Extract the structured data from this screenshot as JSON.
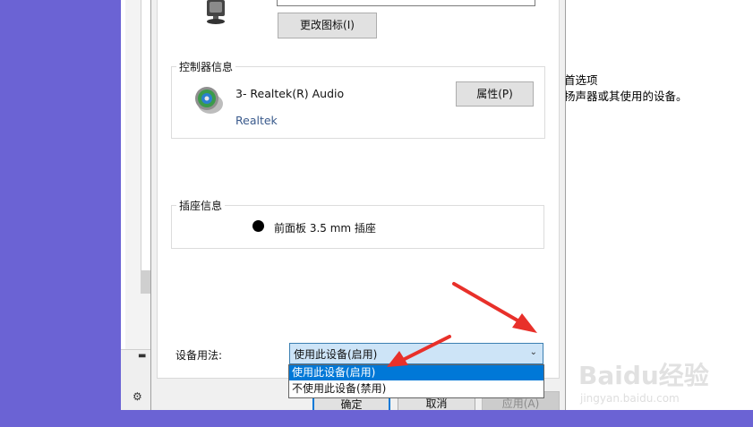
{
  "device_props": {
    "change_icon_button": "更改图标(I)",
    "controller": {
      "group_title": "控制器信息",
      "name": "3- Realtek(R) Audio",
      "vendor_link": "Realtek",
      "properties_button": "属性(P)"
    },
    "jack": {
      "group_title": "插座信息",
      "description": "前面板 3.5 mm 插座"
    },
    "usage": {
      "label": "设备用法:",
      "selected": "使用此设备(启用)",
      "options": [
        "使用此设备(启用)",
        "不使用此设备(禁用)"
      ]
    },
    "buttons": {
      "ok": "确定",
      "cancel": "取消",
      "apply": "应用(A)"
    }
  },
  "background_settings": {
    "heading_fragment": "首选项",
    "desc_fragment": "扬声器或其使用的设备。"
  },
  "watermark": {
    "brand": "Baidu经验",
    "url": "jingyan.baidu.com"
  },
  "colors": {
    "desktop": "#6b63d4",
    "selection": "#0078d7",
    "combo_bg": "#cde4f7",
    "annotation_arrow": "#e8302a"
  }
}
